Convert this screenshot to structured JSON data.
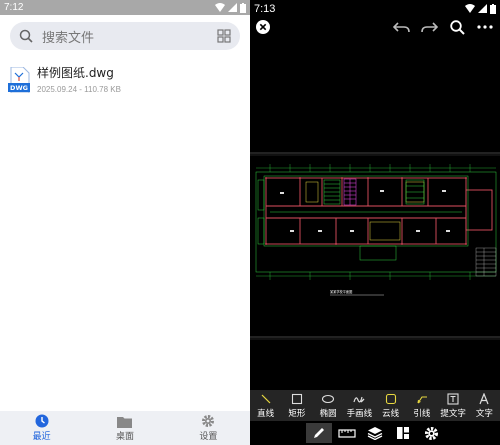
{
  "left": {
    "status_time": "7:12",
    "search": {
      "placeholder": "搜索文件"
    },
    "files": [
      {
        "name": "样例图纸.dwg",
        "meta": "2025.09.24 - 110.78 KB",
        "badge": "DWG"
      }
    ],
    "nav": [
      {
        "label": "最近",
        "icon": "clock-icon",
        "active": true
      },
      {
        "label": "桌面",
        "icon": "folder-icon",
        "active": false
      },
      {
        "label": "设置",
        "icon": "gear-icon",
        "active": false
      }
    ]
  },
  "right": {
    "status_time": "7:13",
    "drawing_title": "某某学校平面图",
    "tools": [
      {
        "label": "直线",
        "icon": "line-icon"
      },
      {
        "label": "矩形",
        "icon": "rectangle-icon"
      },
      {
        "label": "椭圆",
        "icon": "ellipse-icon"
      },
      {
        "label": "手画线",
        "icon": "freehand-icon"
      },
      {
        "label": "云线",
        "icon": "cloud-icon"
      },
      {
        "label": "引线",
        "icon": "leader-icon"
      },
      {
        "label": "提文字",
        "icon": "extract-text-icon"
      },
      {
        "label": "文字",
        "icon": "text-icon"
      }
    ],
    "bottom_icons": [
      "pen-icon",
      "ruler-icon",
      "layers-icon",
      "layout-icon",
      "gear-icon"
    ]
  },
  "colors": {
    "accent": "#2266dd",
    "cad_wall": "#e05060",
    "cad_green": "#2fcf3f",
    "cad_magenta": "#d040d0",
    "cad_yellow": "#e8d840"
  }
}
